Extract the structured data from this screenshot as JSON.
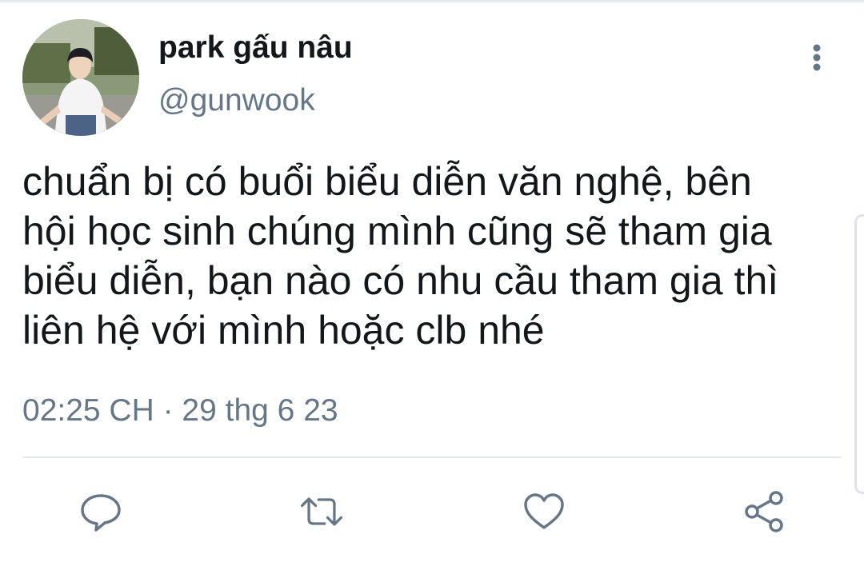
{
  "tweet": {
    "author": {
      "display_name": "park gấu nâu",
      "handle": "@gunwook",
      "avatar": "profile-photo"
    },
    "text_lines": [
      "chuẩn bị có buổi biểu diễn văn nghệ, bên",
      "hội học sinh chúng mình cũng sẽ tham gia",
      "biểu diễn, bạn nào có nhu cầu tham gia thì",
      "liên hệ với mình hoặc clb nhé"
    ],
    "timestamp": "02:25 CH · 29 thg 6 23"
  },
  "actions": [
    {
      "icon": "reply-icon"
    },
    {
      "icon": "retweet-icon"
    },
    {
      "icon": "like-icon"
    },
    {
      "icon": "share-icon"
    }
  ],
  "colors": {
    "text": "#14171a",
    "secondary": "#657786",
    "divider": "#e6e9ec"
  }
}
